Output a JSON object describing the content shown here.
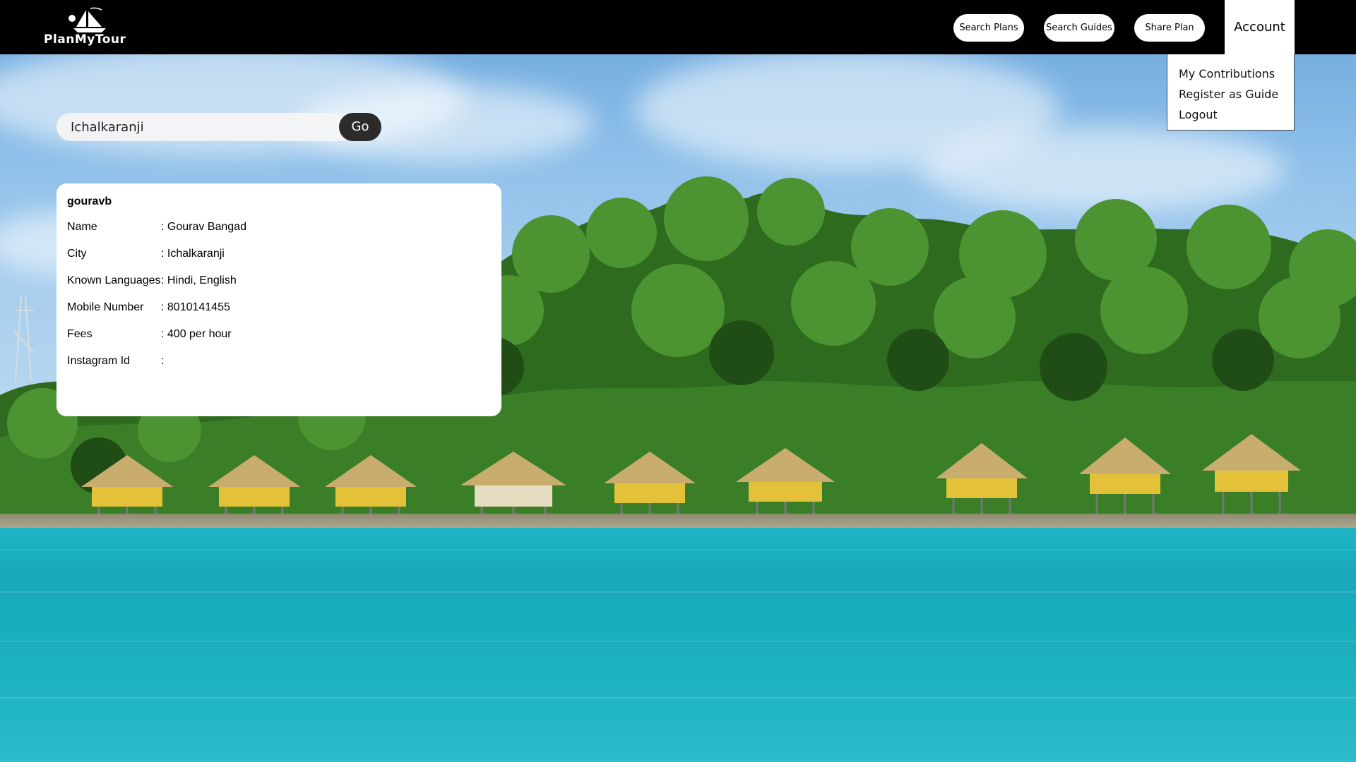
{
  "header": {
    "logo_text": "PlanMyTour",
    "nav": [
      {
        "label": "Search Plans"
      },
      {
        "label": "Search Guides"
      },
      {
        "label": "Share Plan"
      }
    ],
    "account_label": "Account"
  },
  "account_menu": {
    "items": [
      {
        "label": "My Contributions"
      },
      {
        "label": "Register as Guide"
      },
      {
        "label": "Logout"
      }
    ]
  },
  "search": {
    "value": "Ichalkaranji",
    "go_label": "Go"
  },
  "guide": {
    "username": "gouravb",
    "fields": [
      {
        "label": "Name",
        "value": ": Gourav Bangad"
      },
      {
        "label": "City",
        "value": ": Ichalkaranji"
      },
      {
        "label": "Known Languages",
        "value": ": Hindi, English"
      },
      {
        "label": "Mobile Number",
        "value": ": 8010141455"
      },
      {
        "label": "Fees",
        "value": ": 400 per hour"
      },
      {
        "label": "Instagram Id",
        "value": ":"
      }
    ]
  },
  "colors": {
    "header_bg": "#000000",
    "sea": "#1fb4c6",
    "sky": "#8ec0ea",
    "foliage": "#2f6b1f",
    "hut_roof": "#c9ad6e",
    "hut_wall": "#e3c23a"
  }
}
